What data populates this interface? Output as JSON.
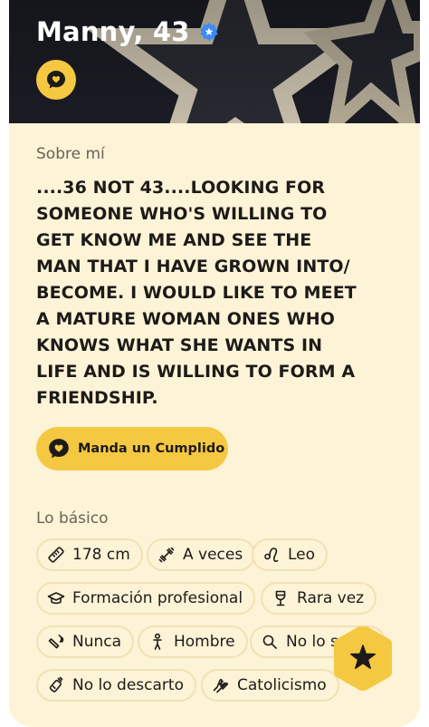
{
  "profile": {
    "name_age": "Manny, 43",
    "verified_icon": "verified-badge-icon",
    "compliment_icon": "heart-chat-icon"
  },
  "about": {
    "label": "Sobre mí",
    "lines": [
      "....36 NOT 43....LOOKING FOR",
      "SOMEONE WHO'S WILLING TO",
      "GET KNOW ME AND SEE THE",
      "MAN THAT I HAVE GROWN INTO/",
      "BECOME. I WOULD LIKE TO MEET",
      "A MATURE WOMAN ONES WHO",
      "KNOWS WHAT SHE WANTS IN",
      "LIFE AND IS WILLING TO FORM A",
      "FRIENDSHIP."
    ]
  },
  "compliment_button": {
    "label": "Manda un Cumplido"
  },
  "basics": {
    "label": "Lo básico",
    "chips": [
      {
        "label": "178 cm",
        "icon": "ruler-icon"
      },
      {
        "label": "A veces",
        "icon": "dumbbell-icon"
      },
      {
        "label": "Leo",
        "icon": "zodiac-icon"
      },
      {
        "label": "Formación profesional",
        "icon": "graduation-cap-icon"
      },
      {
        "label": "Rara vez",
        "icon": "wine-glass-icon"
      },
      {
        "label": "Nunca",
        "icon": "smoking-icon"
      },
      {
        "label": "Hombre",
        "icon": "person-icon"
      },
      {
        "label": "No lo s",
        "icon": "search-icon"
      },
      {
        "label": "No lo descarto",
        "icon": "baby-bottle-icon"
      },
      {
        "label": "Catolicismo",
        "icon": "praying-hands-icon"
      }
    ]
  },
  "fab": {
    "icon": "star-icon"
  },
  "colors": {
    "card_bg": "#fdf3d7",
    "accent": "#f5c842",
    "text": "#1d1b18",
    "muted": "#6b6256",
    "chip_border": "#f1e1b3",
    "verified": "#3d8bf2"
  }
}
